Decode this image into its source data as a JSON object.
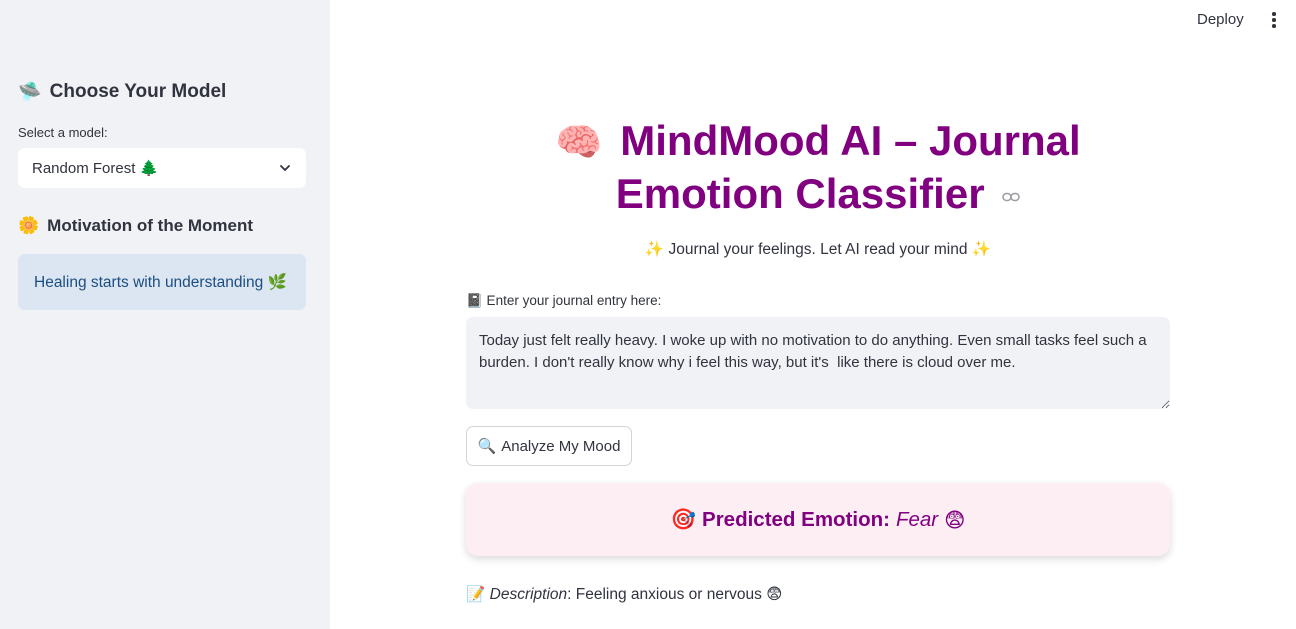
{
  "sidebar": {
    "model_heading_icon": "🛸",
    "model_heading": "Choose Your Model",
    "select_label": "Select a model:",
    "selected_model": "Random Forest 🌲",
    "motivation_heading_icon": "🌼",
    "motivation_heading": "Motivation of the Moment",
    "motivation_text": "Healing starts with understanding 🌿"
  },
  "header": {
    "deploy_label": "Deploy",
    "menu_icon": "kebab-menu-icon"
  },
  "main": {
    "title_icon": "🧠",
    "title": "MindMood AI – Journal Emotion Classifier",
    "subtitle": "✨ Journal your feelings. Let AI read your mind ✨",
    "entry_label": "📓 Enter your journal entry here:",
    "entry_text": "Today just felt really heavy. I woke up with no motivation to do anything. Even small tasks feel such a burden. I don't really know why i feel this way, but it's  like there is cloud over me.",
    "analyze_icon": "🔍",
    "analyze_label": "Analyze My Mood",
    "result_icon": "🎯",
    "result_label": "Predicted Emotion:",
    "result_emotion": "Fear",
    "result_emoji": "😨",
    "desc_icon": "📝",
    "desc_label": "Description",
    "desc_text": ": Feeling anxious or nervous 😨"
  },
  "colors": {
    "title": "#800080",
    "sidebar_bg": "#f0f2f6",
    "motivation_bg": "#dce6f2",
    "result_bg": "#fdeef3"
  }
}
